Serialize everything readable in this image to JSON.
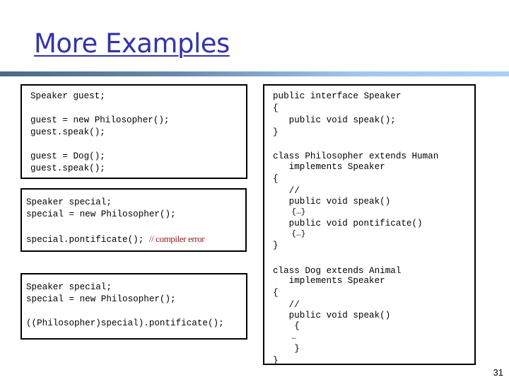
{
  "slide": {
    "title": "More Examples",
    "page_number": "31"
  },
  "boxes": {
    "usage1": {
      "lines": [
        "Speaker guest;",
        "",
        "guest = new Philosopher();",
        "guest.speak();",
        "",
        "guest = Dog();",
        "guest.speak();"
      ]
    },
    "usage2": {
      "lines": [
        "Speaker special;",
        "special = new Philosopher();",
        "",
        "special.pontificate(); "
      ],
      "comment": "// compiler error"
    },
    "usage3": {
      "lines": [
        "Speaker special;",
        "special = new Philosopher();",
        "",
        "((Philosopher)special).pontificate();"
      ]
    },
    "definitions": {
      "interface_lines": [
        "public interface Speaker",
        "{",
        "   public void speak();",
        "}"
      ],
      "philosopher_lines": [
        "class Philosopher extends Human",
        "   implements Speaker",
        "{",
        "   //",
        "   public void speak()",
        "    {…}",
        "   public void pontificate()",
        "    {…}",
        "}"
      ],
      "dog_lines": [
        "class Dog extends Animal",
        "   implements Speaker",
        "{",
        "   //",
        "   public void speak()",
        "    {",
        "    …",
        "    }",
        "}"
      ]
    }
  },
  "colors": {
    "title": "#3333aa",
    "comment": "#8b1a1a"
  }
}
